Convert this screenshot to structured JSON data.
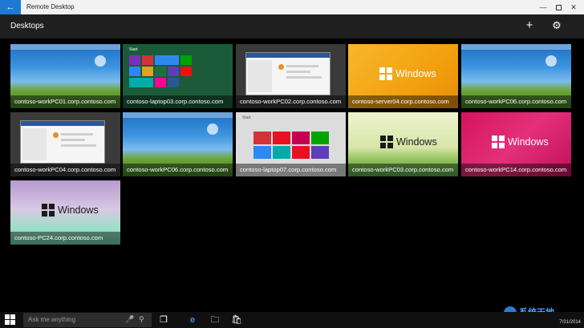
{
  "window": {
    "title": "Remote Desktop",
    "back_icon": "back-arrow-icon"
  },
  "header": {
    "title": "Desktops",
    "add_icon": "plus-icon",
    "settings_icon": "gear-icon"
  },
  "desktops": [
    {
      "name": "contoso-workPC01.corp.contoso.com",
      "thumbnail": "grass-wallpaper"
    },
    {
      "name": "contoso-laptop03.corp.contoso.com",
      "thumbnail": "start-screen"
    },
    {
      "name": "contoso-workPC02.corp.contoso.com",
      "thumbnail": "server-dashboard"
    },
    {
      "name": "contoso-server04.corp.contoso.com",
      "thumbnail": "windows-orange"
    },
    {
      "name": "contoso-workPC06.corp.contoso.com",
      "thumbnail": "grass-wallpaper"
    },
    {
      "name": "contoso-workPC04.corp.contoso.com",
      "thumbnail": "server-dashboard"
    },
    {
      "name": "contoso-workPC06.corp.contoso.com",
      "thumbnail": "grass-wallpaper"
    },
    {
      "name": "contoso-laptop07.corp.contoso.com",
      "thumbnail": "start-screen-light"
    },
    {
      "name": "contoso-workPC03.corp.contoso.com",
      "thumbnail": "windows-hills"
    },
    {
      "name": "contoso-workPC14.corp.contoso.com",
      "thumbnail": "windows-magenta"
    },
    {
      "name": "contoso-PC24.corp.contoso.com",
      "thumbnail": "windows-purple"
    }
  ],
  "thumbnail_text": {
    "windows_word": "Windows",
    "start_label": "Start",
    "dashboard_label": "Dashboard"
  },
  "taskbar": {
    "search_placeholder": "Ask me anything",
    "clock_date": "7/31/2014"
  },
  "watermark": {
    "text": "系统天地"
  },
  "colors": {
    "accent": "#1f78d1",
    "header_bg": "#1f1f1f",
    "background": "#000000"
  }
}
